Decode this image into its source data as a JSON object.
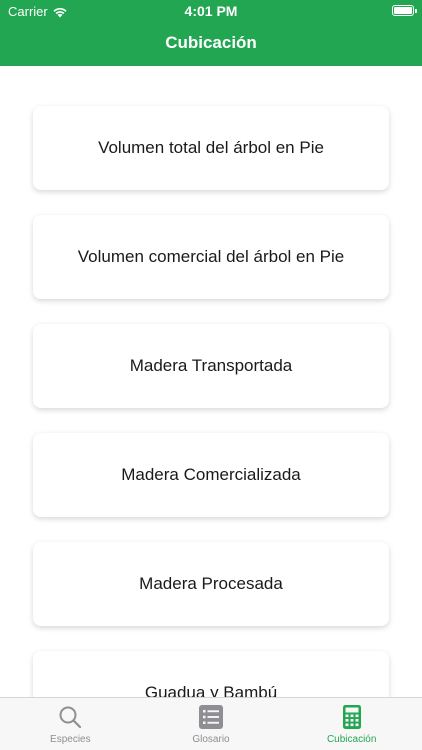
{
  "status": {
    "carrier": "Carrier",
    "time": "4:01 PM"
  },
  "nav": {
    "title": "Cubicación"
  },
  "items": [
    {
      "label": "Volumen total del árbol en Pie"
    },
    {
      "label": "Volumen comercial del árbol en Pie"
    },
    {
      "label": "Madera Transportada"
    },
    {
      "label": "Madera Comercializada"
    },
    {
      "label": "Madera Procesada"
    },
    {
      "label": "Guadua y Bambú"
    }
  ],
  "tabs": [
    {
      "label": "Especies",
      "icon": "search-icon",
      "active": false
    },
    {
      "label": "Glosario",
      "icon": "list-icon",
      "active": false
    },
    {
      "label": "Cubicación",
      "icon": "calculator-icon",
      "active": true
    }
  ],
  "colors": {
    "accent": "#22a652",
    "inactive": "#8e8e93"
  }
}
